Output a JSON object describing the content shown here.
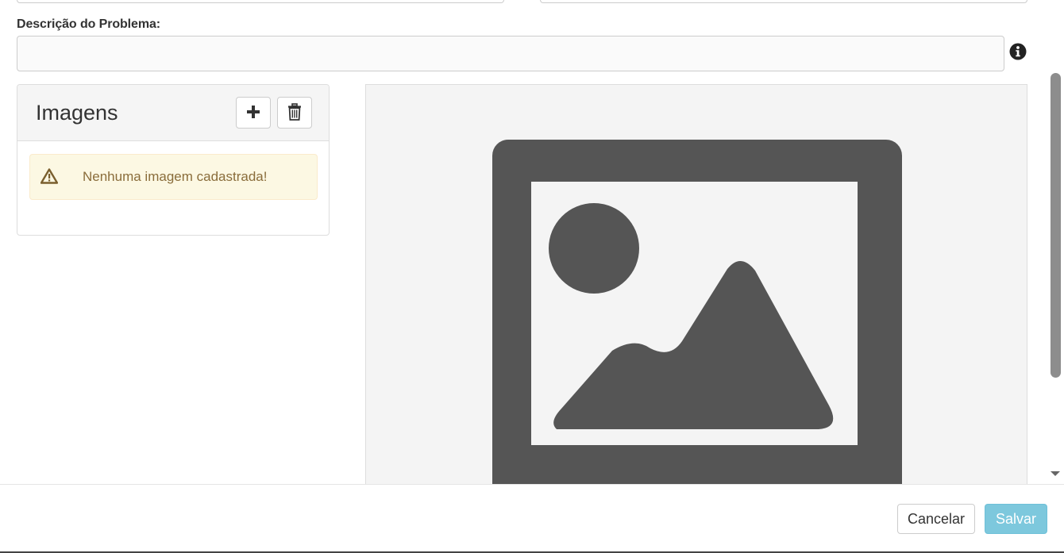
{
  "form": {
    "description_label": "Descrição do Problema:",
    "description_value": "",
    "description_placeholder": ""
  },
  "images_panel": {
    "title": "Imagens",
    "add_icon": "plus-icon",
    "delete_icon": "trash-icon",
    "empty_message": "Nenhuma imagem cadastrada!",
    "empty_icon": "warning-icon"
  },
  "preview": {
    "placeholder_icon": "image-placeholder-icon"
  },
  "footer": {
    "cancel_label": "Cancelar",
    "save_label": "Salvar"
  },
  "colors": {
    "alert_background": "#fcf8e3",
    "alert_text": "#8a6d3b",
    "save_button": "#7dc8dd",
    "placeholder_dark": "#555555"
  }
}
